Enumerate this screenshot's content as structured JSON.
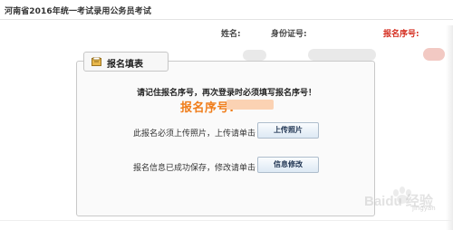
{
  "header": {
    "title": "河南省2016年统一考试录用公务员考试"
  },
  "userbar": {
    "name_label": "姓名:",
    "id_label": "身份证号:",
    "regno_label": "报名序号:"
  },
  "panel": {
    "tab_label": "报名填表",
    "notice": "请记住报名序号，再次登录时必须填写报名序号！",
    "regno_label": "报名序号:",
    "upload_prompt": "此报名必须上传照片，上传请单击",
    "upload_button": "上传照片",
    "edit_prompt": "报名信息已成功保存，修改请单击",
    "edit_button": "信息修改"
  },
  "watermark": {
    "text": "Baidu 经验",
    "subtext": "jingyan"
  },
  "colors": {
    "accent_red": "#d42a1c",
    "regno_orange": "#f07d1a",
    "button_text": "#1f3452"
  }
}
